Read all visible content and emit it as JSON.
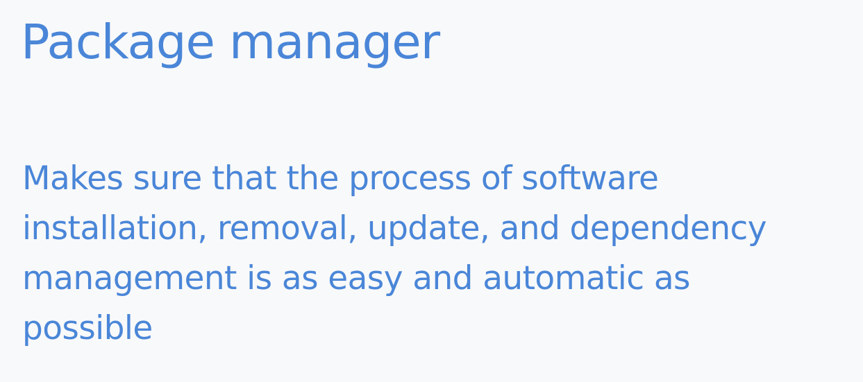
{
  "slide": {
    "title": "Package manager",
    "body_lines": [
      "Makes sure that the process of software",
      "installation, removal, update, and dependency",
      "management is as easy and automatic as",
      "possible"
    ]
  },
  "colors": {
    "background": "#f8f9fa",
    "text": "#4a86d8"
  }
}
